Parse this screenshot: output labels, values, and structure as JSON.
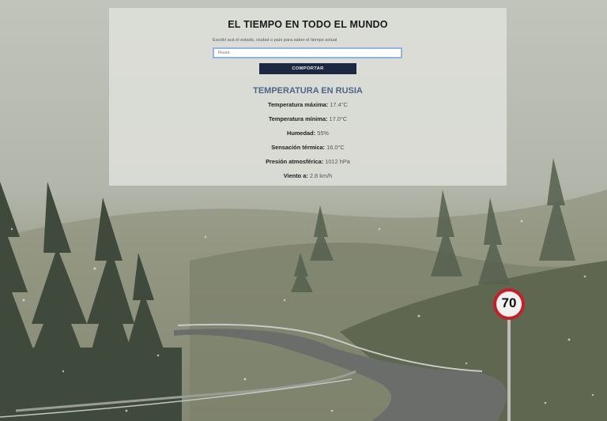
{
  "app": {
    "title": "EL TIEMPO EN TODO EL MUNDO",
    "hint": "Escribí acá el estado, ciudad o país para saber el tiempo actual",
    "search_placeholder": "Rusia",
    "button_label": "COMPORTAR"
  },
  "result": {
    "heading": "TEMPERATURA EN RUSIA",
    "rows": [
      {
        "label": "Temperatura máxima:",
        "value": "17.4°C"
      },
      {
        "label": "Temperatura mínima:",
        "value": "17.0°C"
      },
      {
        "label": "Humedad:",
        "value": "55%"
      },
      {
        "label": "Sensación térmica:",
        "value": "16.0°C"
      },
      {
        "label": "Presión atmosférica:",
        "value": "1012 hPa"
      },
      {
        "label": "Viento a:",
        "value": "2.8 km/h"
      }
    ]
  },
  "background": {
    "road_sign": "70"
  },
  "colors": {
    "accent": "#1c2741",
    "heading": "#4f6487",
    "input_border": "#8fb4e8",
    "sign_red": "#c4202b"
  }
}
